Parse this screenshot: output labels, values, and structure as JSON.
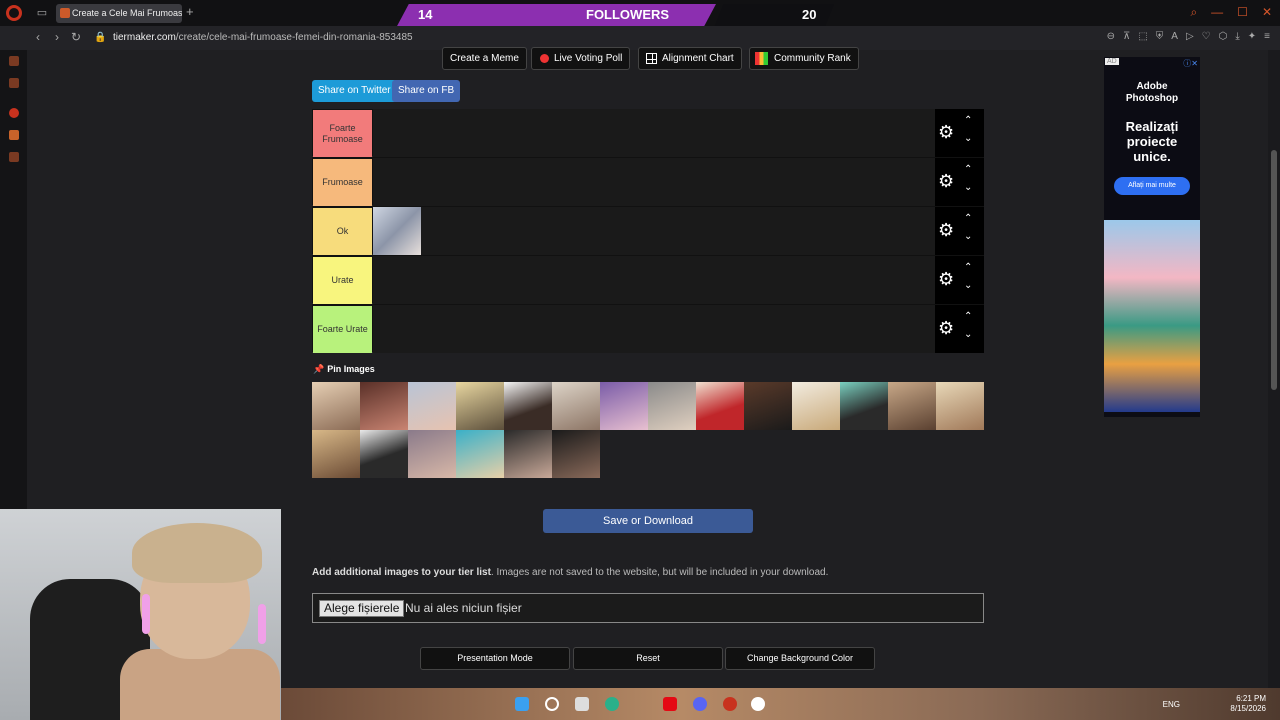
{
  "browser": {
    "tab_title": "Create a Cele Mai Frumoase",
    "new_tab": "+",
    "url_host": "tiermaker.com",
    "url_path": "/create/cele-mai-frumoase-femei-din-romania-853485"
  },
  "stream_overlay": {
    "left_count": "14",
    "label": "FOLLOWERS",
    "right_count": "20"
  },
  "toolbar": {
    "create_meme": "Create a Meme",
    "live_voting": "Live Voting Poll",
    "alignment_chart": "Alignment Chart",
    "community_rank": "Community Rank",
    "share_twitter": "Share on Twitter",
    "share_fb": "Share on FB"
  },
  "tiers": [
    {
      "label": "Foarte Frumoase",
      "color": "#f27b7b"
    },
    {
      "label": "Frumoase",
      "color": "#f6b97c"
    },
    {
      "label": "Ok",
      "color": "#f7dc7c"
    },
    {
      "label": "Urate",
      "color": "#f8f57e"
    },
    {
      "label": "Foarte Urate",
      "color": "#b8f27c"
    }
  ],
  "pin_images_label": "Pin Images",
  "save_button": "Save or Download",
  "add_images": {
    "bold": "Add additional images to your tier list",
    "rest": ". Images are not saved to the website, but will be included in your download.",
    "choose_button": "Alege fișierele",
    "status": "Nu ai ales niciun fișier"
  },
  "bottom_buttons": {
    "presentation": "Presentation Mode",
    "reset": "Reset",
    "change_bg": "Change Background Color"
  },
  "ad": {
    "tag": "AD",
    "brand": "Adobe Photoshop",
    "headline": "Realizați proiecte unice.",
    "cta": "Aflați mai multe"
  },
  "system_tray": {
    "lang": "ENG",
    "time": "6:21 PM",
    "date": "8/15/2026"
  },
  "colors": {
    "accent": "#8c2fb0",
    "twitter": "#1da1f2",
    "facebook": "#4267b2",
    "save": "#3b5a96"
  }
}
